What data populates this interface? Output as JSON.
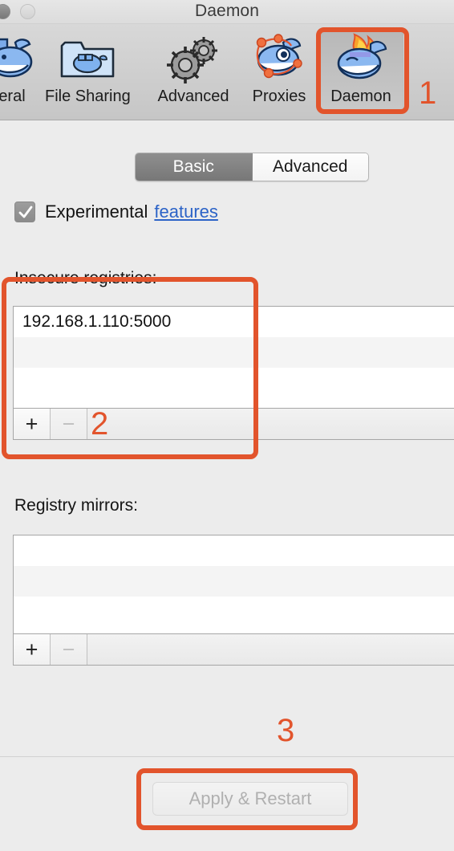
{
  "window": {
    "title": "Daemon",
    "controls": [
      "close-button",
      "minimize-button"
    ]
  },
  "toolbar": {
    "items": [
      {
        "label": "eral",
        "icon": "whale-icon",
        "selected": false,
        "full_label": "General"
      },
      {
        "label": "File Sharing",
        "icon": "folder-whale-icon",
        "selected": false
      },
      {
        "label": "Advanced",
        "icon": "gears-icon",
        "selected": false
      },
      {
        "label": "Proxies",
        "icon": "whale-network-icon",
        "selected": false
      },
      {
        "label": "Daemon",
        "icon": "whale-flame-icon",
        "selected": true
      }
    ]
  },
  "segmented": {
    "options": [
      "Basic",
      "Advanced"
    ],
    "selected": "Basic"
  },
  "experimental": {
    "checked": true,
    "label": "Experimental",
    "link": "features"
  },
  "insecure_registries": {
    "label": "Insecure registries:",
    "rows": [
      "192.168.1.110:5000",
      "",
      ""
    ],
    "add_button": "+",
    "remove_button": "−",
    "remove_disabled": true
  },
  "registry_mirrors": {
    "label": "Registry mirrors:",
    "rows": [
      "",
      "",
      ""
    ],
    "add_button": "+",
    "remove_button": "−",
    "remove_disabled": true
  },
  "footer": {
    "apply_label": "Apply & Restart",
    "apply_disabled": true
  },
  "annotations": {
    "color": "#e2542c",
    "markers": [
      {
        "number": "1",
        "target": "daemon-toolbar-item"
      },
      {
        "number": "2",
        "target": "insecure-registries-section"
      },
      {
        "number": "3",
        "target": "apply-restart-button"
      }
    ]
  }
}
